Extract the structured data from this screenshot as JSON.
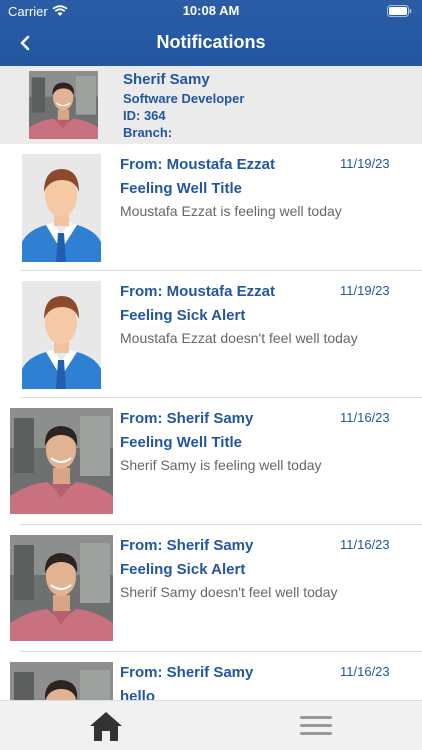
{
  "status_bar": {
    "carrier": "Carrier",
    "time": "10:08 AM"
  },
  "nav": {
    "title": "Notifications",
    "back_icon": "chevron-left-icon"
  },
  "profile": {
    "name": "Sherif Samy",
    "role": "Software Developer",
    "id_line": "ID: 364",
    "branch_line": "Branch:"
  },
  "notifications": [
    {
      "avatar": "generic-avatar",
      "from": "From: Moustafa Ezzat",
      "date": "11/19/23",
      "title": "Feeling Well Title",
      "body": "Moustafa Ezzat is feeling well today"
    },
    {
      "avatar": "generic-avatar",
      "from": "From: Moustafa Ezzat",
      "date": "11/19/23",
      "title": "Feeling Sick Alert",
      "body": "Moustafa Ezzat doesn't feel well today"
    },
    {
      "avatar": "photo-avatar",
      "from": "From: Sherif Samy",
      "date": "11/16/23",
      "title": "Feeling Well Title",
      "body": "Sherif Samy is feeling well today"
    },
    {
      "avatar": "photo-avatar",
      "from": "From: Sherif Samy",
      "date": "11/16/23",
      "title": "Feeling Sick Alert",
      "body": "Sherif Samy doesn't feel well today"
    },
    {
      "avatar": "photo-avatar",
      "from": "From: Sherif Samy",
      "date": "11/16/23",
      "title": "hello",
      "body": ""
    }
  ],
  "tabbar": {
    "home_icon": "home-icon",
    "menu_icon": "hamburger-menu-icon"
  },
  "colors": {
    "brand_blue": "#2356a1",
    "profile_bg": "#ebebeb",
    "body_gray": "#666666",
    "tabbar_bg": "#f1f1f1"
  }
}
